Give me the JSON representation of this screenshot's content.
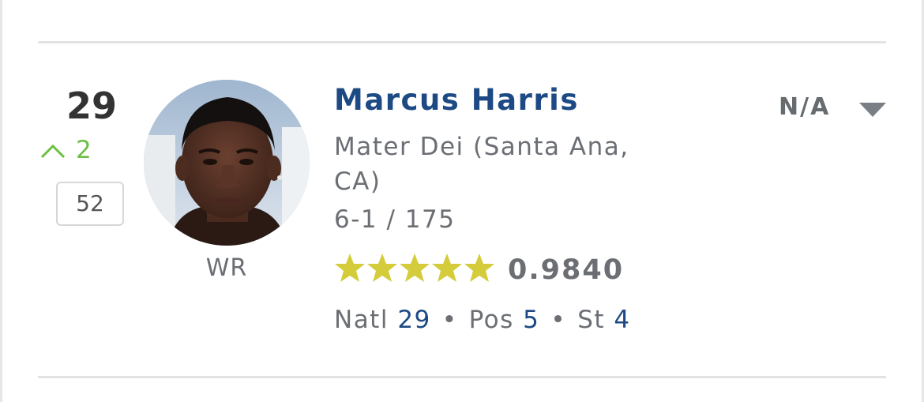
{
  "player": {
    "rank": "29",
    "change": {
      "direction": "up",
      "value": "2",
      "icon": "chevron-up-icon",
      "color": "#6cbf43"
    },
    "previous_rank": "52",
    "position": "WR",
    "name": "Marcus Harris",
    "school": "Mater Dei (Santa Ana, CA)",
    "height_weight": "6-1 / 175",
    "stars": 5,
    "rating": "0.9840",
    "rankings": {
      "natl_label": "Natl",
      "natl_value": "29",
      "pos_label": "Pos",
      "pos_value": "5",
      "st_label": "St",
      "st_value": "4",
      "separator": "•"
    },
    "commitment": "N/A",
    "avatar_icon": "player-headshot"
  },
  "colors": {
    "name_blue": "#1d4a84",
    "star_yellow": "#d4cc3a",
    "text_gray": "#6b6f74",
    "rank_dark": "#333333",
    "change_green": "#6cbf43",
    "caret_gray": "#7a7f85"
  }
}
